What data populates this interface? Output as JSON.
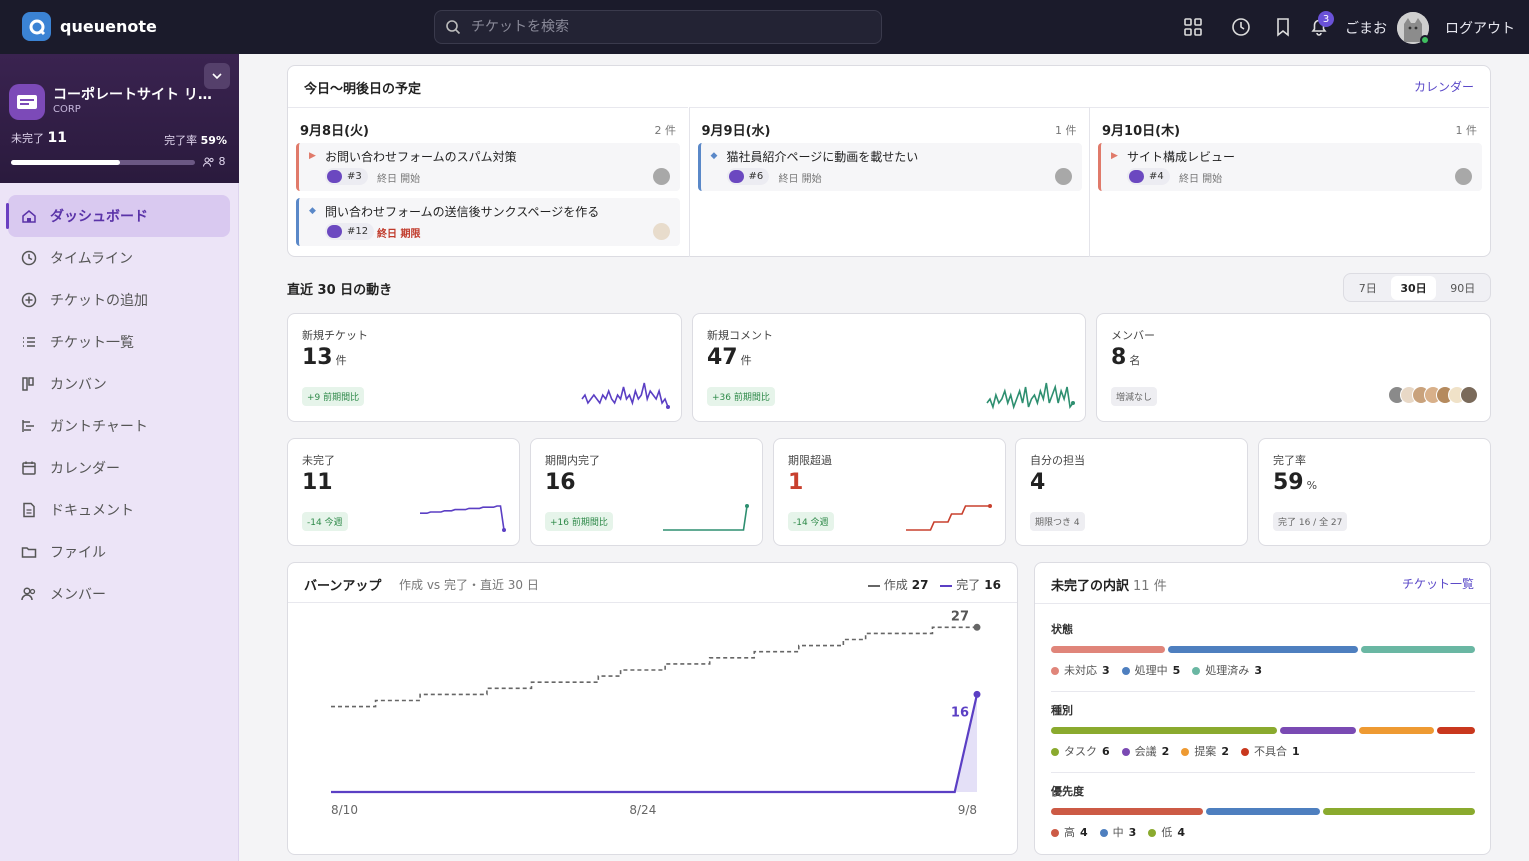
{
  "app": {
    "name": "queuenote"
  },
  "search": {
    "placeholder": "チケットを検索"
  },
  "header": {
    "notification_count": "3",
    "username": "ごまお",
    "logout_label": "ログアウト"
  },
  "project": {
    "name": "コーポレートサイト リニューアル",
    "code": "CORP",
    "open_label": "未完了",
    "open_count": "11",
    "completion_label": "完了率",
    "completion_rate": "59%",
    "completion_fraction": 0.59,
    "member_count": "8"
  },
  "nav": [
    {
      "label": "ダッシュボード",
      "icon": "home-icon",
      "active": true
    },
    {
      "label": "タイムライン",
      "icon": "clock-icon"
    },
    {
      "label": "チケットの追加",
      "icon": "plus-circle-icon"
    },
    {
      "label": "チケット一覧",
      "icon": "list-icon"
    },
    {
      "label": "カンバン",
      "icon": "kanban-icon"
    },
    {
      "label": "ガントチャート",
      "icon": "gantt-icon"
    },
    {
      "label": "カレンダー",
      "icon": "calendar-icon"
    },
    {
      "label": "ドキュメント",
      "icon": "document-icon"
    },
    {
      "label": "ファイル",
      "icon": "folder-icon"
    },
    {
      "label": "メンバー",
      "icon": "users-icon"
    }
  ],
  "schedule": {
    "title": "今日〜明後日の予定",
    "link": "カレンダー",
    "days": [
      {
        "date": "9月8日(火)",
        "count": "2 件",
        "tickets": [
          {
            "title": "お問い合わせフォームのスパム対策",
            "id": "#3",
            "status": "終日 開始",
            "due": false,
            "color": "red"
          },
          {
            "title": "問い合わせフォームの送信後サンクスページを作る",
            "id": "#12",
            "status": "終日 期限",
            "due": true,
            "color": "blue"
          }
        ]
      },
      {
        "date": "9月9日(水)",
        "count": "1 件",
        "tickets": [
          {
            "title": "猫社員紹介ページに動画を載せたい",
            "id": "#6",
            "status": "終日 開始",
            "due": false,
            "color": "blue"
          }
        ]
      },
      {
        "date": "9月10日(木)",
        "count": "1 件",
        "tickets": [
          {
            "title": "サイト構成レビュー",
            "id": "#4",
            "status": "終日 開始",
            "due": false,
            "color": "red"
          }
        ]
      }
    ]
  },
  "activity": {
    "title": "直近 30 日の動き",
    "ranges": [
      "7日",
      "30日",
      "90日"
    ],
    "selected_range": "30日"
  },
  "stats_big": [
    {
      "label": "新規チケット",
      "value": "13",
      "unit": "件",
      "tag": "+9 前期間比",
      "spark_color": "#5b3fc4",
      "spark": [
        2,
        3,
        1,
        2,
        3,
        2,
        1,
        3,
        2,
        4,
        2,
        1,
        3,
        2,
        5,
        2,
        3,
        1,
        4,
        2,
        3,
        6,
        2,
        4,
        3,
        2,
        4,
        1,
        2,
        0
      ]
    },
    {
      "label": "新規コメント",
      "value": "47",
      "unit": "件",
      "tag": "+36 前期間比",
      "spark_color": "#2e8f70",
      "spark": [
        2,
        3,
        1,
        4,
        2,
        3,
        5,
        2,
        4,
        1,
        3,
        5,
        2,
        6,
        1,
        3,
        4,
        2,
        5,
        3,
        7,
        2,
        4,
        6,
        2,
        5,
        3,
        6,
        1,
        2
      ]
    },
    {
      "label": "メンバー",
      "value": "8",
      "unit": "名",
      "tag": "増減なし"
    }
  ],
  "stats_small": [
    {
      "label": "未完了",
      "value": "11",
      "tag": "-14 今週",
      "spark_color": "#5b3fc4",
      "red": false,
      "spark": [
        25,
        25,
        25,
        26,
        26,
        26,
        26,
        27,
        27,
        27,
        28,
        28,
        28,
        28,
        29,
        29,
        29,
        29,
        30,
        30,
        30,
        30,
        31,
        31,
        11
      ]
    },
    {
      "label": "期間内完了",
      "value": "16",
      "tag": "+16 前期間比",
      "spark_color": "#2e8f70",
      "red": false,
      "spark": [
        0,
        0,
        0,
        0,
        0,
        0,
        0,
        0,
        0,
        0,
        0,
        0,
        0,
        0,
        0,
        0,
        0,
        0,
        0,
        0,
        0,
        0,
        0,
        0,
        16
      ]
    },
    {
      "label": "期限超過",
      "value": "1",
      "tag": "-14 今週",
      "spark_color": "#c8402e",
      "red": true,
      "spark": [
        0,
        0,
        0,
        0,
        0,
        0,
        0,
        0,
        1,
        1,
        1,
        1,
        1,
        2,
        2,
        2,
        2,
        3,
        3,
        3,
        3,
        3,
        3,
        3,
        3
      ]
    },
    {
      "label": "自分の担当",
      "value": "4",
      "tag": "期限つき 4",
      "tag_gray": true
    },
    {
      "label": "完了率",
      "value": "59",
      "unit": "%",
      "tag": "完了 16 / 全 27",
      "tag_gray": true
    }
  ],
  "burnup": {
    "title": "バーンアップ",
    "subtitle": "作成 vs 完了・直近 30 日",
    "legend_created": "作成",
    "legend_done": "完了",
    "created_total": "27",
    "done_total": "16"
  },
  "chart_data": {
    "type": "line",
    "x": [
      "8/10",
      "8/11",
      "8/12",
      "8/13",
      "8/14",
      "8/15",
      "8/16",
      "8/17",
      "8/18",
      "8/19",
      "8/20",
      "8/21",
      "8/22",
      "8/23",
      "8/24",
      "8/25",
      "8/26",
      "8/27",
      "8/28",
      "8/29",
      "8/30",
      "8/31",
      "9/1",
      "9/2",
      "9/3",
      "9/4",
      "9/5",
      "9/6",
      "9/7",
      "9/8"
    ],
    "xticks": [
      "8/10",
      "8/24",
      "9/8"
    ],
    "series": [
      {
        "name": "作成",
        "values": [
          14,
          14,
          15,
          15,
          16,
          16,
          16,
          17,
          17,
          18,
          18,
          18,
          19,
          20,
          20,
          21,
          21,
          22,
          22,
          23,
          23,
          24,
          24,
          25,
          26,
          26,
          26,
          27,
          27,
          27
        ]
      },
      {
        "name": "完了",
        "values": [
          0,
          0,
          0,
          0,
          0,
          0,
          0,
          0,
          0,
          0,
          0,
          0,
          0,
          0,
          0,
          0,
          0,
          0,
          0,
          0,
          0,
          0,
          0,
          0,
          0,
          0,
          0,
          0,
          0,
          16
        ]
      }
    ],
    "ylim": [
      0,
      30
    ],
    "end_labels": [
      "27",
      "16"
    ],
    "grid": false
  },
  "breakdown": {
    "title": "未完了の内訳",
    "count": "11 件",
    "link": "チケット一覧",
    "sections": [
      {
        "title": "状態",
        "items": [
          {
            "label": "未対応",
            "value": "3",
            "color": "#e0857a"
          },
          {
            "label": "処理中",
            "value": "5",
            "color": "#4e7fbf"
          },
          {
            "label": "処理済み",
            "value": "3",
            "color": "#6ab7a3"
          }
        ]
      },
      {
        "title": "種別",
        "items": [
          {
            "label": "タスク",
            "value": "6",
            "color": "#8aaa2e"
          },
          {
            "label": "会議",
            "value": "2",
            "color": "#7a4ab3"
          },
          {
            "label": "提案",
            "value": "2",
            "color": "#ee9a32"
          },
          {
            "label": "不具合",
            "value": "1",
            "color": "#c9381e"
          }
        ]
      },
      {
        "title": "優先度",
        "items": [
          {
            "label": "高",
            "value": "4",
            "color": "#cc5a45"
          },
          {
            "label": "中",
            "value": "3",
            "color": "#4e7fbf"
          },
          {
            "label": "低",
            "value": "4",
            "color": "#8aaa2e"
          }
        ]
      }
    ]
  }
}
